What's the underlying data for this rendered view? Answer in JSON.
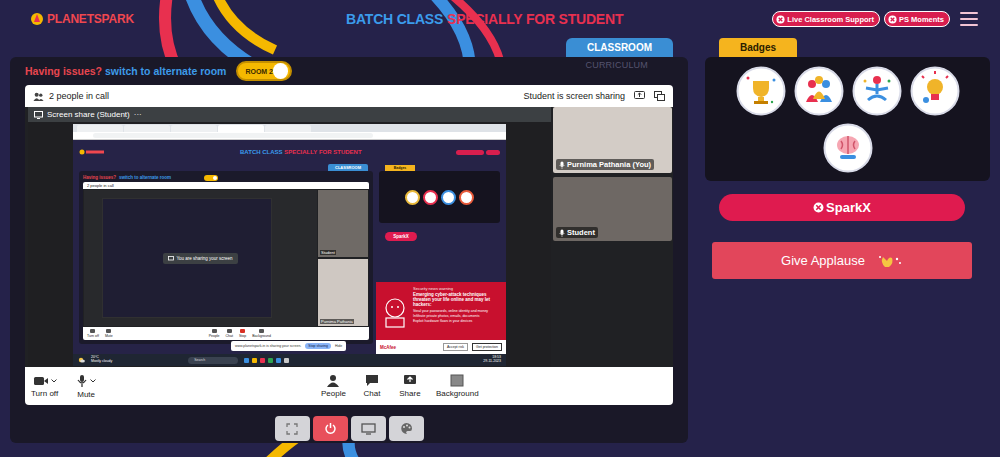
{
  "header": {
    "logo": "PLANETSPARK",
    "title": [
      {
        "text": "BATCH CLASS",
        "color": "#3b9cec"
      },
      {
        "text": "SPECIALLY FOR STUDENT",
        "color": "#e8304f"
      }
    ],
    "actions": [
      {
        "label": "Live Classroom Support"
      },
      {
        "label": "PS Moments"
      }
    ]
  },
  "tabs": [
    {
      "label": "CLASSROOM",
      "selected": true
    },
    {
      "label": "CURRICULUM",
      "selected": false
    }
  ],
  "room": {
    "issue_lead": "Having issues?",
    "issue_rest": "switch to alternate room",
    "toggle": {
      "label": "ROOM 2",
      "on": true
    }
  },
  "call": {
    "people": "2 people in call",
    "sharing": "Student is screen sharing",
    "share_label": "Screen share (Student)",
    "share_more": "···",
    "participants": [
      {
        "name": "Purnima Pathania (You)",
        "kind": "light"
      },
      {
        "name": "Student",
        "kind": "dark"
      }
    ],
    "toolbar": [
      {
        "label": "Turn off",
        "kind": "camera"
      },
      {
        "label": "Mute",
        "kind": "mic"
      },
      {
        "label": "People",
        "kind": "people"
      },
      {
        "label": "Chat",
        "kind": "chat"
      },
      {
        "label": "Share",
        "kind": "share"
      },
      {
        "label": "Background",
        "kind": "background"
      }
    ]
  },
  "controls": [
    {
      "kind": "fullscreen",
      "highlighted": false
    },
    {
      "kind": "leave",
      "highlighted": true
    },
    {
      "kind": "present",
      "highlighted": false
    },
    {
      "kind": "theme",
      "highlighted": false
    }
  ],
  "badges": {
    "title": "Badges",
    "items": [
      {
        "kind": "trophy"
      },
      {
        "kind": "team"
      },
      {
        "kind": "yoga"
      },
      {
        "kind": "idea"
      },
      {
        "kind": "brain"
      }
    ]
  },
  "sparkx": {
    "label": "SparkX"
  },
  "applause": {
    "label": "Give Applause"
  },
  "shared_screen": {
    "title": [
      {
        "text": "BATCH CLASS",
        "color": "#3b9cec"
      },
      {
        "text": "SPECIALLY FOR STUDENT",
        "color": "#e8304f"
      }
    ],
    "tab": "CLASSROOM",
    "issue_lead": "Having issues?",
    "issue_rest": "switch to alternate room",
    "people": "2 people in call",
    "notice": "You are sharing your screen",
    "participants": [
      {
        "name": "Student"
      },
      {
        "name": "Purnima Pathania"
      }
    ],
    "toolbar": [
      {
        "label": "Turn off"
      },
      {
        "label": "Mute"
      },
      {
        "label": "People"
      },
      {
        "label": "Chat"
      },
      {
        "label": "Stop"
      },
      {
        "label": "Background"
      }
    ],
    "badges_title": "Badges",
    "badges": [
      {
        "kind": "trophy"
      },
      {
        "kind": "team"
      },
      {
        "kind": "yoga"
      },
      {
        "kind": "idea"
      }
    ],
    "sparkx": "SparkX",
    "popup": {
      "heading": "Security news warning",
      "body": "Emerging cyber-attack techniques threaten your life online and may let hackers:",
      "bullets": [
        "Steal your passwords, online identity and money",
        "Infiltrate private photos, emails, documents",
        "Exploit hardware flaws in your devices"
      ],
      "brand": "McAfee",
      "buttons": [
        "Accept risk",
        "Get protection"
      ]
    },
    "share_bar": {
      "text": "www.planetspark.in is sharing your screen.",
      "stop": "Stop sharing",
      "hide": "Hide"
    },
    "taskbar": {
      "temp": "20°C",
      "weather": "Mostly cloudy",
      "search": "Search",
      "time": "18:53",
      "date": "29-11-2023"
    }
  }
}
